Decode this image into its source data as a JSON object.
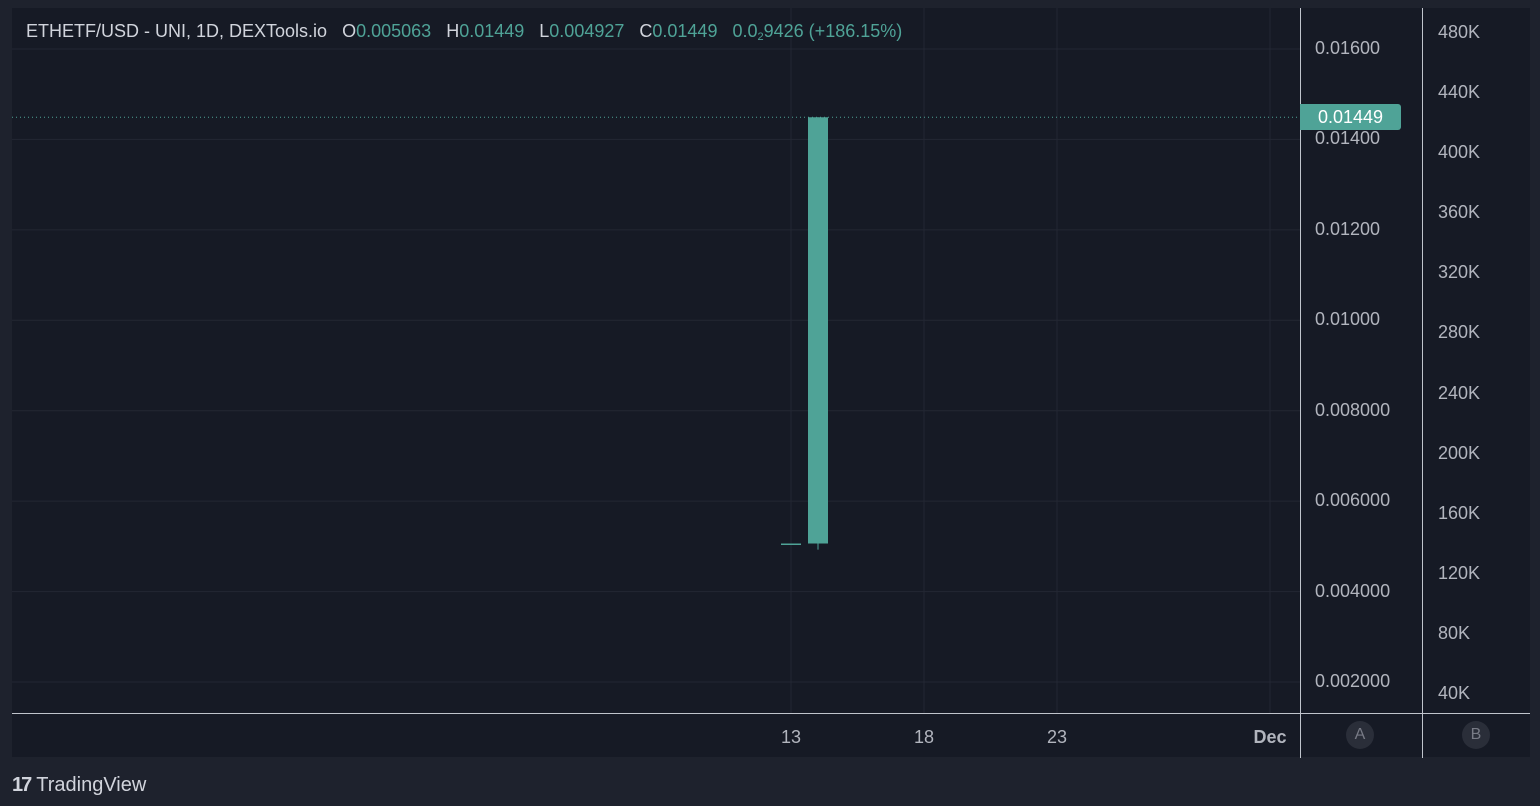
{
  "legend": {
    "symbol": "ETHETF/USD - UNI, 1D, DEXTools.io",
    "open_key": "O",
    "open": "0.005063",
    "high_key": "H",
    "high": "0.01449",
    "low_key": "L",
    "low": "0.004927",
    "close_key": "C",
    "close": "0.01449",
    "change_prefix": "0.0",
    "change_sub": "2",
    "change_rest": "9426 (+186.15%)"
  },
  "last_price_label": "0.01449",
  "price_axis_labels": [
    "0.01600",
    "0.01400",
    "0.01200",
    "0.01000",
    "0.008000",
    "0.006000",
    "0.004000",
    "0.002000"
  ],
  "volume_axis_labels": [
    "480K",
    "440K",
    "400K",
    "360K",
    "320K",
    "280K",
    "240K",
    "200K",
    "160K",
    "120K",
    "80K",
    "40K"
  ],
  "time_axis_labels": [
    "13",
    "18",
    "23",
    "Dec"
  ],
  "scale_buttons": {
    "a": "A",
    "b": "B"
  },
  "branding": {
    "icon": "tradingview-logo-icon",
    "text": "TradingView"
  },
  "colors": {
    "up": "#4fa397",
    "background": "#161a25",
    "grid": "#232733"
  },
  "chart_data": {
    "type": "candlestick",
    "x_ticks": [
      "13",
      "18",
      "23",
      "Dec"
    ],
    "y_ticks_price": [
      0.016,
      0.014,
      0.012,
      0.01,
      0.008,
      0.006,
      0.004,
      0.002
    ],
    "y_ticks_volume": [
      480000,
      440000,
      400000,
      360000,
      320000,
      280000,
      240000,
      200000,
      160000,
      120000,
      80000,
      40000
    ],
    "candles": [
      {
        "date": "Nov 13",
        "open": 0.005063,
        "high": 0.005063,
        "low": 0.005063,
        "close": 0.005063
      },
      {
        "date": "Nov 14",
        "open": 0.005063,
        "high": 0.01449,
        "low": 0.004927,
        "close": 0.01449
      }
    ],
    "last_price": 0.01449,
    "grid": true
  }
}
